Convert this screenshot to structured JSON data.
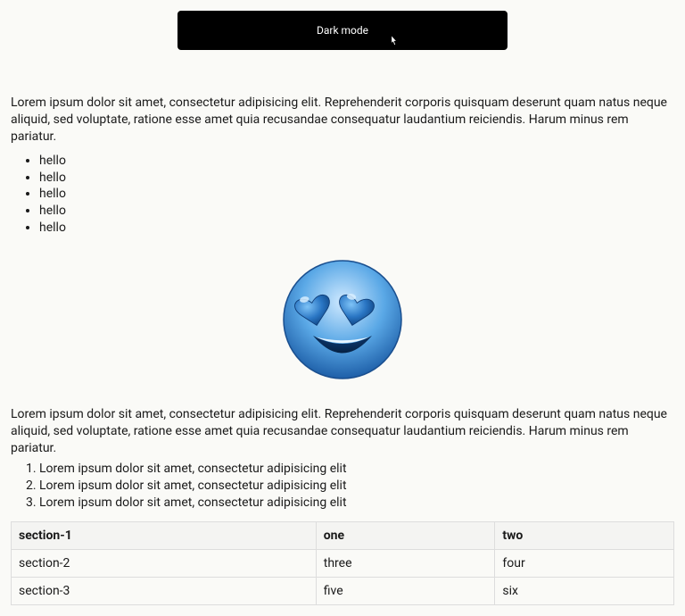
{
  "button": {
    "label": "Dark mode"
  },
  "paragraph1": "Lorem ipsum dolor sit amet, consectetur adipisicing elit. Reprehenderit corporis quisquam deserunt quam natus neque aliquid, sed voluptate, ratione esse amet quia recusandae consequatur laudantium reiciendis. Harum minus rem pariatur.",
  "bullets": [
    "hello",
    "hello",
    "hello",
    "hello",
    "hello"
  ],
  "paragraph2": "Lorem ipsum dolor sit amet, consectetur adipisicing elit. Reprehenderit corporis quisquam deserunt quam natus neque aliquid, sed voluptate, ratione esse amet quia recusandae consequatur laudantium reiciendis. Harum minus rem pariatur.",
  "ordered": [
    "Lorem ipsum dolor sit amet, consectetur adipisicing elit",
    "Lorem ipsum dolor sit amet, consectetur adipisicing elit",
    "Lorem ipsum dolor sit amet, consectetur adipisicing elit"
  ],
  "table": {
    "headers": [
      "section-1",
      "one",
      "two"
    ],
    "rows": [
      [
        "section-2",
        "three",
        "four"
      ],
      [
        "section-3",
        "five",
        "six"
      ]
    ]
  }
}
